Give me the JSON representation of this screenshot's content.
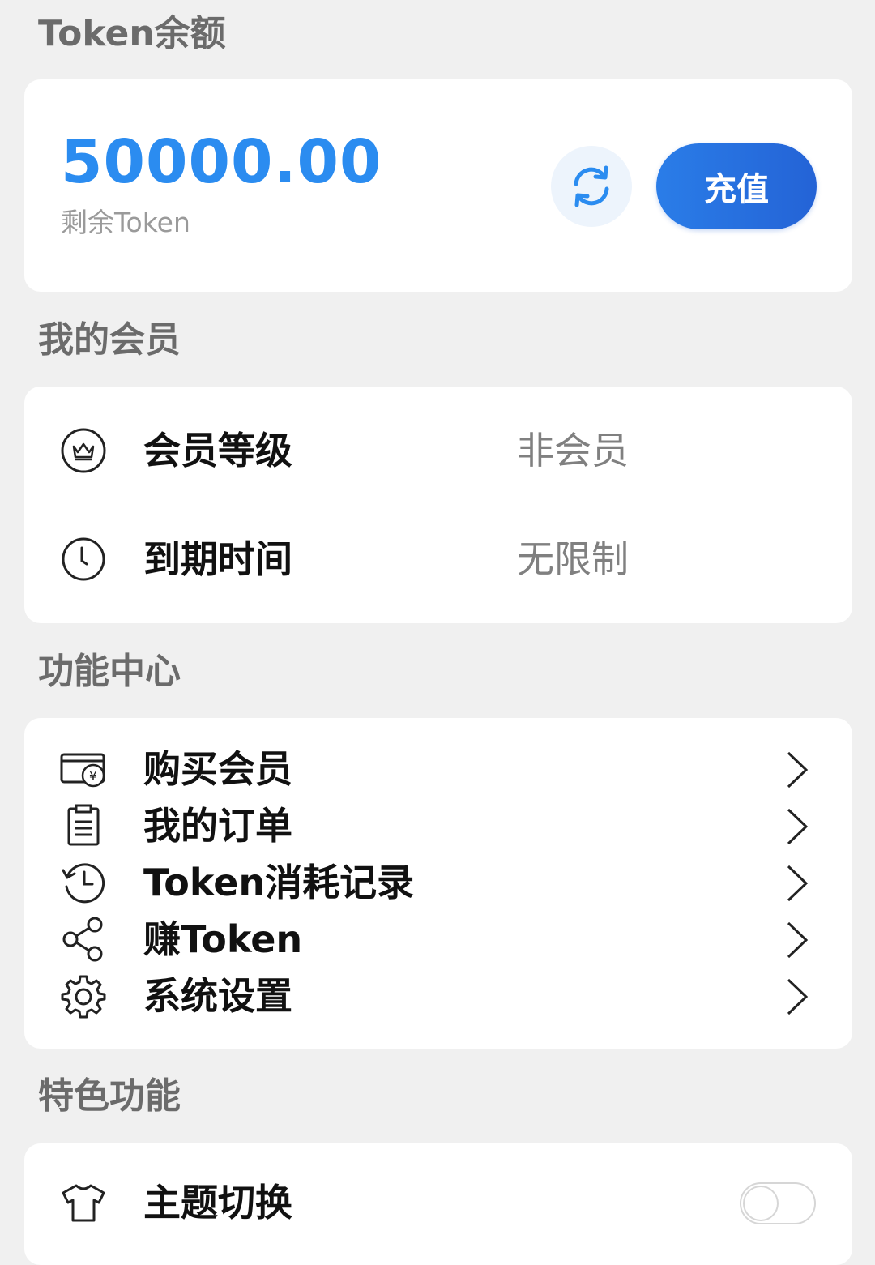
{
  "token_section": {
    "title": "Token余额",
    "amount": "50000.00",
    "sub_label": "剩余Token",
    "refresh_icon": "refresh-icon",
    "recharge_label": "充值"
  },
  "membership_section": {
    "title": "我的会员",
    "rows": [
      {
        "icon": "crown-icon",
        "label": "会员等级",
        "value": "非会员"
      },
      {
        "icon": "clock-icon",
        "label": "到期时间",
        "value": "无限制"
      }
    ]
  },
  "function_section": {
    "title": "功能中心",
    "items": [
      {
        "icon": "wallet-yen-icon",
        "label": "购买会员"
      },
      {
        "icon": "clipboard-icon",
        "label": "我的订单"
      },
      {
        "icon": "history-icon",
        "label": "Token消耗记录"
      },
      {
        "icon": "share-icon",
        "label": "赚Token"
      },
      {
        "icon": "gear-icon",
        "label": "系统设置"
      }
    ]
  },
  "feature_section": {
    "title": "特色功能",
    "items": [
      {
        "icon": "shirt-icon",
        "label": "主题切换",
        "toggle": "off"
      }
    ]
  },
  "colors": {
    "accent": "#2b8cf0",
    "button": "#2463d6",
    "background": "#f0f0f0"
  }
}
